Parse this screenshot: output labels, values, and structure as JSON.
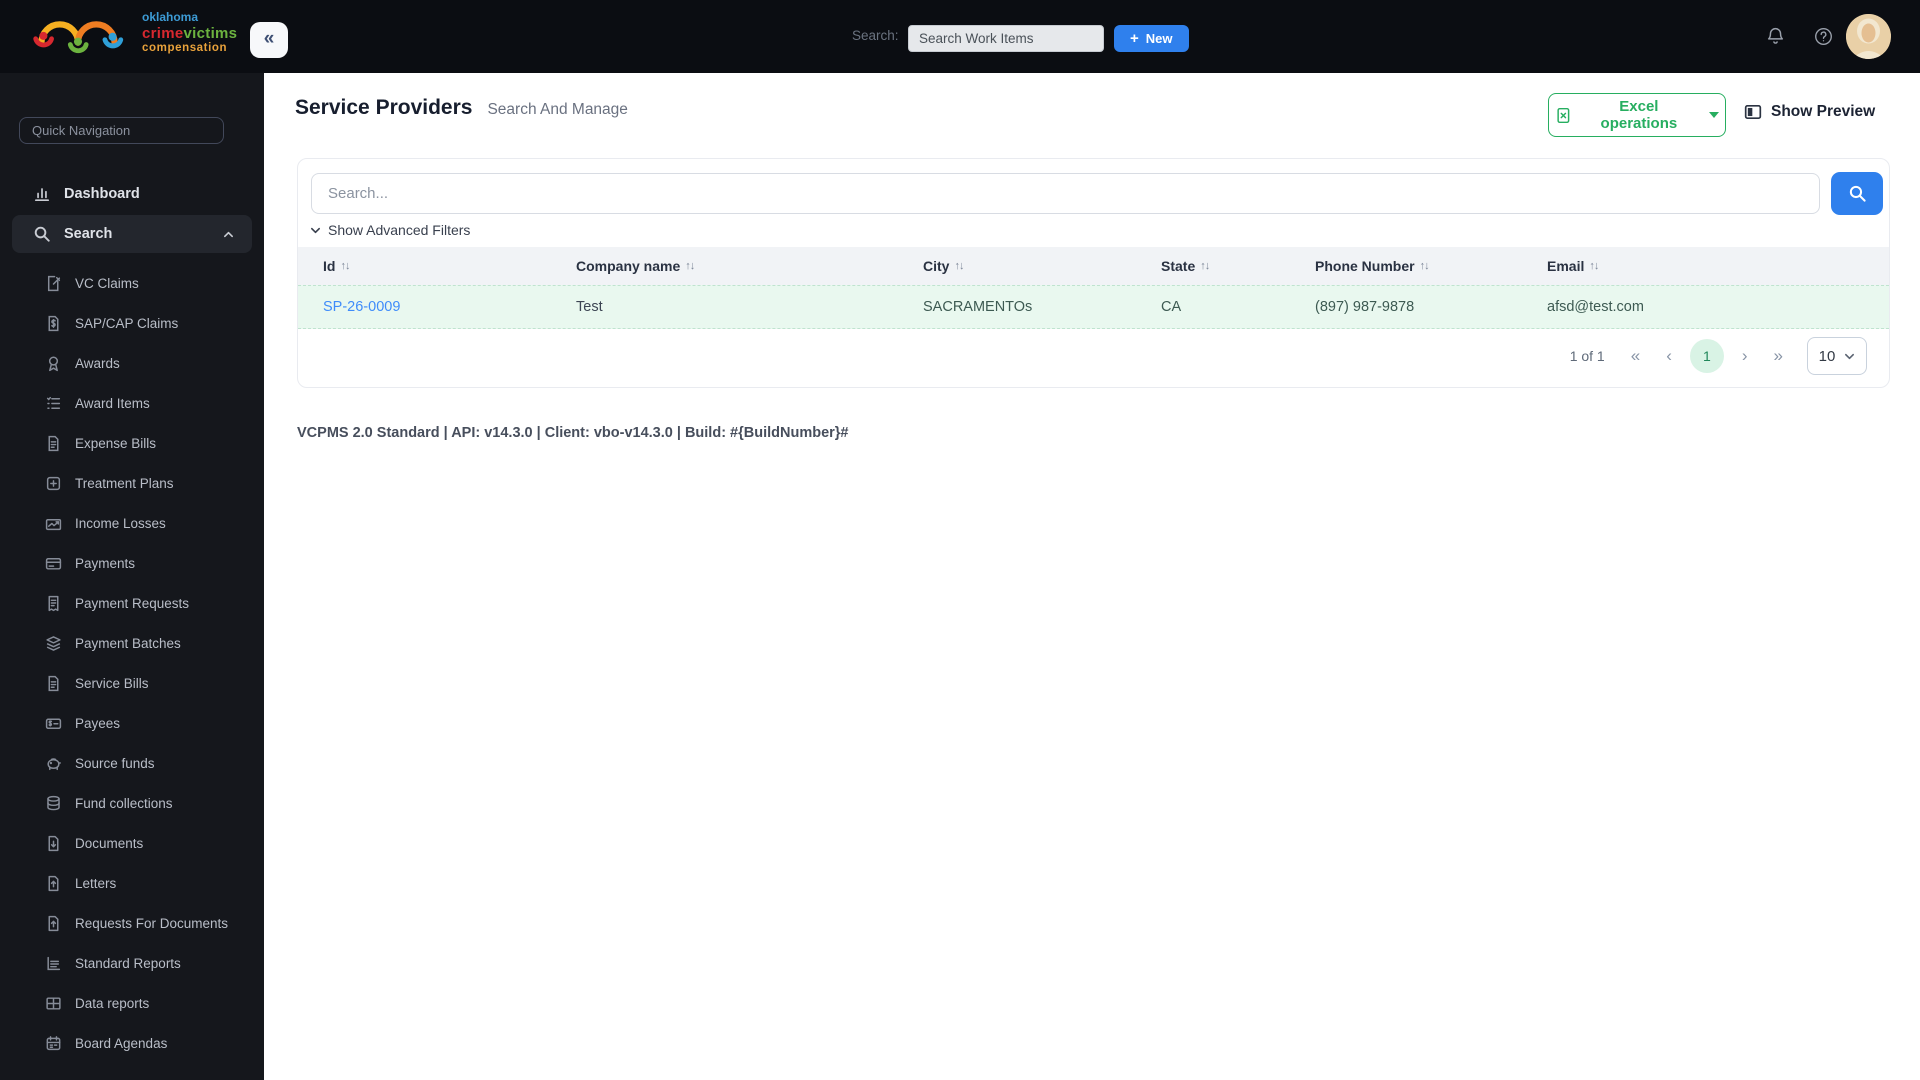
{
  "topbar": {
    "logo": {
      "line1": "oklahoma",
      "line2a": "crime",
      "line2b": "victims",
      "line3": "compensation"
    },
    "search_label": "Search:",
    "search_placeholder": "Search Work Items",
    "new_button_label": "New"
  },
  "icons": {
    "plus": "+",
    "first_page": "«",
    "prev_page": "‹",
    "next_page": "›",
    "last_page": "»",
    "sort": "↑↓",
    "collapse_sidebar": "«"
  },
  "sidebar": {
    "quick_nav_placeholder": "Quick Navigation",
    "dashboard_label": "Dashboard",
    "search_label": "Search",
    "items": [
      {
        "label": "VC Claims",
        "icon": "document-edit-icon"
      },
      {
        "label": "SAP/CAP Claims",
        "icon": "document-dollar-icon"
      },
      {
        "label": "Awards",
        "icon": "medal-icon"
      },
      {
        "label": "Award Items",
        "icon": "list-icon"
      },
      {
        "label": "Expense Bills",
        "icon": "document-icon"
      },
      {
        "label": "Treatment Plans",
        "icon": "square-plus-icon"
      },
      {
        "label": "Income Losses",
        "icon": "money-trend-icon"
      },
      {
        "label": "Payments",
        "icon": "credit-card-icon"
      },
      {
        "label": "Payment Requests",
        "icon": "receipt-icon"
      },
      {
        "label": "Payment Batches",
        "icon": "layers-icon"
      },
      {
        "label": "Service Bills",
        "icon": "document-icon"
      },
      {
        "label": "Payees",
        "icon": "card-dollar-icon"
      },
      {
        "label": "Source funds",
        "icon": "piggy-bank-icon"
      },
      {
        "label": "Fund collections",
        "icon": "coins-icon"
      },
      {
        "label": "Documents",
        "icon": "document-down-icon"
      },
      {
        "label": "Letters",
        "icon": "document-up-icon"
      },
      {
        "label": "Requests For Documents",
        "icon": "document-up-icon"
      },
      {
        "label": "Standard Reports",
        "icon": "report-chart-icon"
      },
      {
        "label": "Data reports",
        "icon": "table-grid-icon"
      },
      {
        "label": "Board Agendas",
        "icon": "calendar-icon"
      }
    ]
  },
  "main": {
    "title": "Service Providers",
    "subtitle": "Search And Manage",
    "excel_button_label": "Excel operations",
    "show_preview_label": "Show Preview",
    "search_placeholder": "Search...",
    "advanced_filters_label": "Show Advanced Filters",
    "table": {
      "columns": [
        "Id",
        "Company name",
        "City",
        "State",
        "Phone Number",
        "Email"
      ],
      "rows": [
        {
          "id": "SP-26-0009",
          "company": "Test",
          "city": "SACRAMENTOs",
          "state": "CA",
          "phone": "(897) 987-9878",
          "email": "afsd@test.com"
        }
      ]
    },
    "pagination": {
      "info": "1 of 1",
      "current_page": "1",
      "page_size": "10"
    },
    "footer": "VCPMS 2.0 Standard | API: v14.3.0 | Client: vbo-v14.3.0 | Build: #{BuildNumber}#"
  },
  "colors": {
    "topbar_bg": "#0b0d12",
    "sidebar_bg": "#15171c",
    "accent_blue": "#2f80ed",
    "accent_green": "#27ae60",
    "link_blue": "#3f8cfa",
    "row_highlight": "#e9f8ef",
    "table_header_bg": "#f1f3f6"
  }
}
